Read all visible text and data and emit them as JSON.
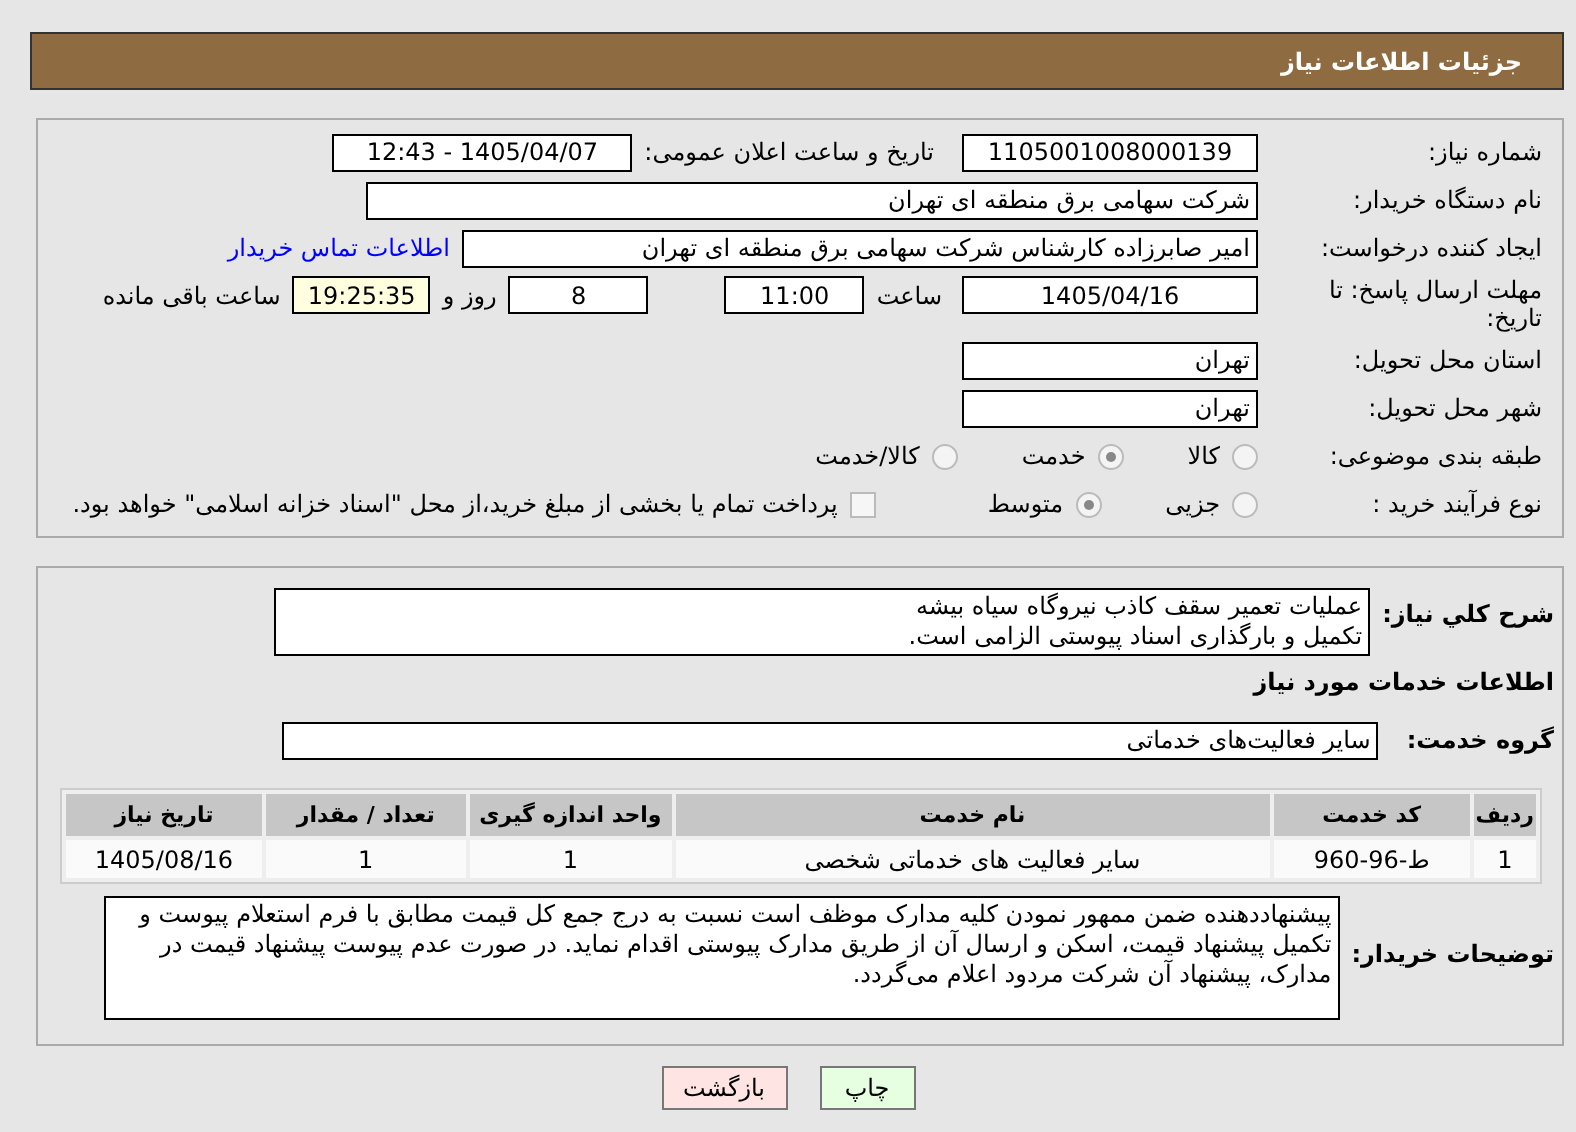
{
  "header": {
    "title": "جزئیات اطلاعات نیاز"
  },
  "fields": {
    "need_number": {
      "label": "شماره نیاز:",
      "value": "1105001008000139"
    },
    "announce": {
      "label": "تاریخ و ساعت اعلان عمومی:",
      "value": "1405/04/07 - 12:43"
    },
    "buyer": {
      "label": "نام دستگاه خریدار:",
      "value": "شرکت سهامی برق منطقه ای تهران"
    },
    "creator": {
      "label": "ایجاد کننده درخواست:",
      "value": "امیر صابرزاده کارشناس شرکت سهامی برق منطقه ای تهران",
      "link": "اطلاعات تماس خریدار"
    },
    "deadline": {
      "label": "مهلت ارسال پاسخ: تا تاریخ:",
      "date": "1405/04/16",
      "time_label": "ساعت",
      "time": "11:00",
      "days": "8",
      "days_label": "روز و",
      "remaining": "19:25:35",
      "remaining_label": "ساعت باقی مانده"
    },
    "province": {
      "label": "استان محل تحویل:",
      "value": "تهران"
    },
    "city": {
      "label": "شهر محل تحویل:",
      "value": "تهران"
    }
  },
  "category": {
    "label": "طبقه بندی موضوعی:",
    "options": [
      {
        "label": "کالا",
        "selected": false
      },
      {
        "label": "خدمت",
        "selected": true
      },
      {
        "label": "کالا/خدمت",
        "selected": false
      }
    ]
  },
  "process": {
    "label": "نوع فرآیند خرید :",
    "options": [
      {
        "label": "جزیی",
        "selected": false
      },
      {
        "label": "متوسط",
        "selected": true
      }
    ],
    "payment": {
      "checked": false,
      "label": "پرداخت تمام یا بخشی از مبلغ خرید،از محل \"اسناد خزانه اسلامی\" خواهد بود."
    }
  },
  "summary": {
    "label": "شرح کلي نیاز:",
    "lines": [
      "عملیات تعمیر سقف کاذب نیروگاه سیاه بیشه",
      "تکمیل و بارگذاری اسناد پیوستی الزامی است."
    ]
  },
  "services_title": "اطلاعات خدمات مورد نیاز",
  "service_group": {
    "label": "گروه خدمت:",
    "value": "سایر فعالیت‌های خدماتی"
  },
  "table": {
    "columns": [
      "ردیف",
      "کد خدمت",
      "نام خدمت",
      "واحد اندازه گیری",
      "تعداد / مقدار",
      "تاریخ نیاز"
    ],
    "rows": [
      [
        "1",
        "ط-96-960",
        "سایر فعالیت های خدماتی شخصی",
        "1",
        "1",
        "1405/08/16"
      ]
    ]
  },
  "notes": {
    "label": "توضیحات خریدار:",
    "value": "پیشنهاددهنده ضمن ممهور نمودن کلیه مدارک موظف است نسبت به درج جمع کل قیمت مطابق با فرم استعلام پیوست و تکمیل پیشنهاد قیمت، اسکن و ارسال آن از طریق مدارک پیوستی اقدام نماید. در صورت عدم پیوست پیشنهاد قیمت در مدارک، پیشنهاد آن شرکت مردود اعلام می‌گردد."
  },
  "buttons": [
    {
      "label": "چاپ",
      "kind": "print"
    },
    {
      "label": "بازگشت",
      "kind": "back"
    }
  ]
}
